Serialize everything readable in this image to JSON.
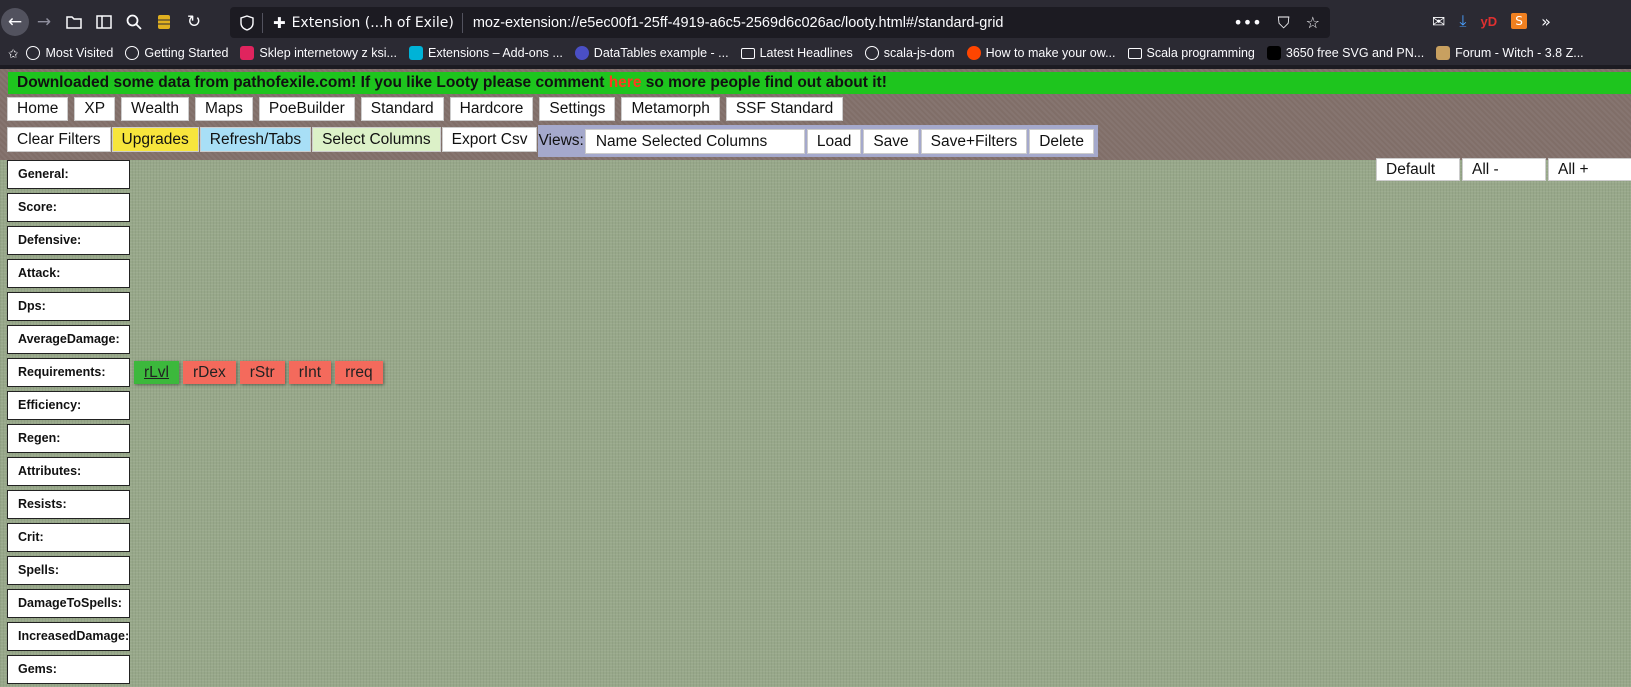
{
  "browser": {
    "tab_identity": "Extension (...h of Exile)",
    "url": "moz-extension://e5ec00f1-25ff-4919-a6c5-2569d6c026ac/looty.html#/standard-grid",
    "more_actions": "•••",
    "bookmarks": [
      {
        "label": "Most Visited",
        "icon": "gear-icon",
        "color": "#fbfbfe"
      },
      {
        "label": "Getting Started",
        "icon": "globe-icon",
        "color": "#fbfbfe"
      },
      {
        "label": "Sklep internetowy z ksi...",
        "icon": "shop-icon",
        "color": "#e0245e"
      },
      {
        "label": "Extensions – Add-ons ...",
        "icon": "puzzle-icon",
        "color": "#00b3d7"
      },
      {
        "label": "DataTables example - ...",
        "icon": "datatables-icon",
        "color": "#4a4fc5"
      },
      {
        "label": "Latest Headlines",
        "icon": "folder-icon",
        "color": "#fbfbfe"
      },
      {
        "label": "scala-js-dom",
        "icon": "globe-icon",
        "color": "#fbfbfe"
      },
      {
        "label": "How to make your ow...",
        "icon": "reddit-icon",
        "color": "#ff4500"
      },
      {
        "label": "Scala programming",
        "icon": "folder-icon",
        "color": "#fbfbfe"
      },
      {
        "label": "3650 free SVG and PN...",
        "icon": "square-icon",
        "color": "#000000"
      },
      {
        "label": "Forum - Witch - 3.8 Z...",
        "icon": "eye-icon",
        "color": "#c8a060"
      }
    ]
  },
  "banner": {
    "before": "Downloaded some data from pathofexile.com! If you like Looty please comment ",
    "link": "here",
    "after": " so more people find out about it!"
  },
  "nav": [
    "Home",
    "XP",
    "Wealth",
    "Maps",
    "PoeBuilder",
    "Standard",
    "Hardcore",
    "Settings",
    "Metamorph",
    "SSF Standard"
  ],
  "toolbar": {
    "clear_filters": "Clear Filters",
    "upgrades": "Upgrades",
    "refresh_tabs": "Refresh/Tabs",
    "select_columns": "Select Columns",
    "export_csv": "Export Csv",
    "views_label": "Views:",
    "views_input_placeholder": "Name Selected Columns",
    "load": "Load",
    "save": "Save",
    "save_filters": "Save+Filters",
    "delete": "Delete"
  },
  "sidebar": [
    "General:",
    "Score:",
    "Defensive:",
    "Attack:",
    "Dps:",
    "AverageDamage:",
    "Requirements:",
    "Efficiency:",
    "Regen:",
    "Attributes:",
    "Resists:",
    "Crit:",
    "Spells:",
    "DamageToSpells:",
    "IncreasedDamage:",
    "Gems:"
  ],
  "requirements": [
    {
      "label": "rLvl",
      "active": true
    },
    {
      "label": "rDex",
      "active": false
    },
    {
      "label": "rStr",
      "active": false
    },
    {
      "label": "rInt",
      "active": false
    },
    {
      "label": "rreq",
      "active": false
    }
  ],
  "right_buttons": {
    "default": "Default",
    "all_minus": "All -",
    "all_plus": "All +"
  },
  "colors": {
    "banner": "#1ec51e",
    "link": "#ff3b1e",
    "chip_on": "#3cb83c",
    "chip_off": "#f46a5c",
    "upgrades": "#f7e53c",
    "refresh": "#a8dff6",
    "select": "#dcf1c8"
  }
}
